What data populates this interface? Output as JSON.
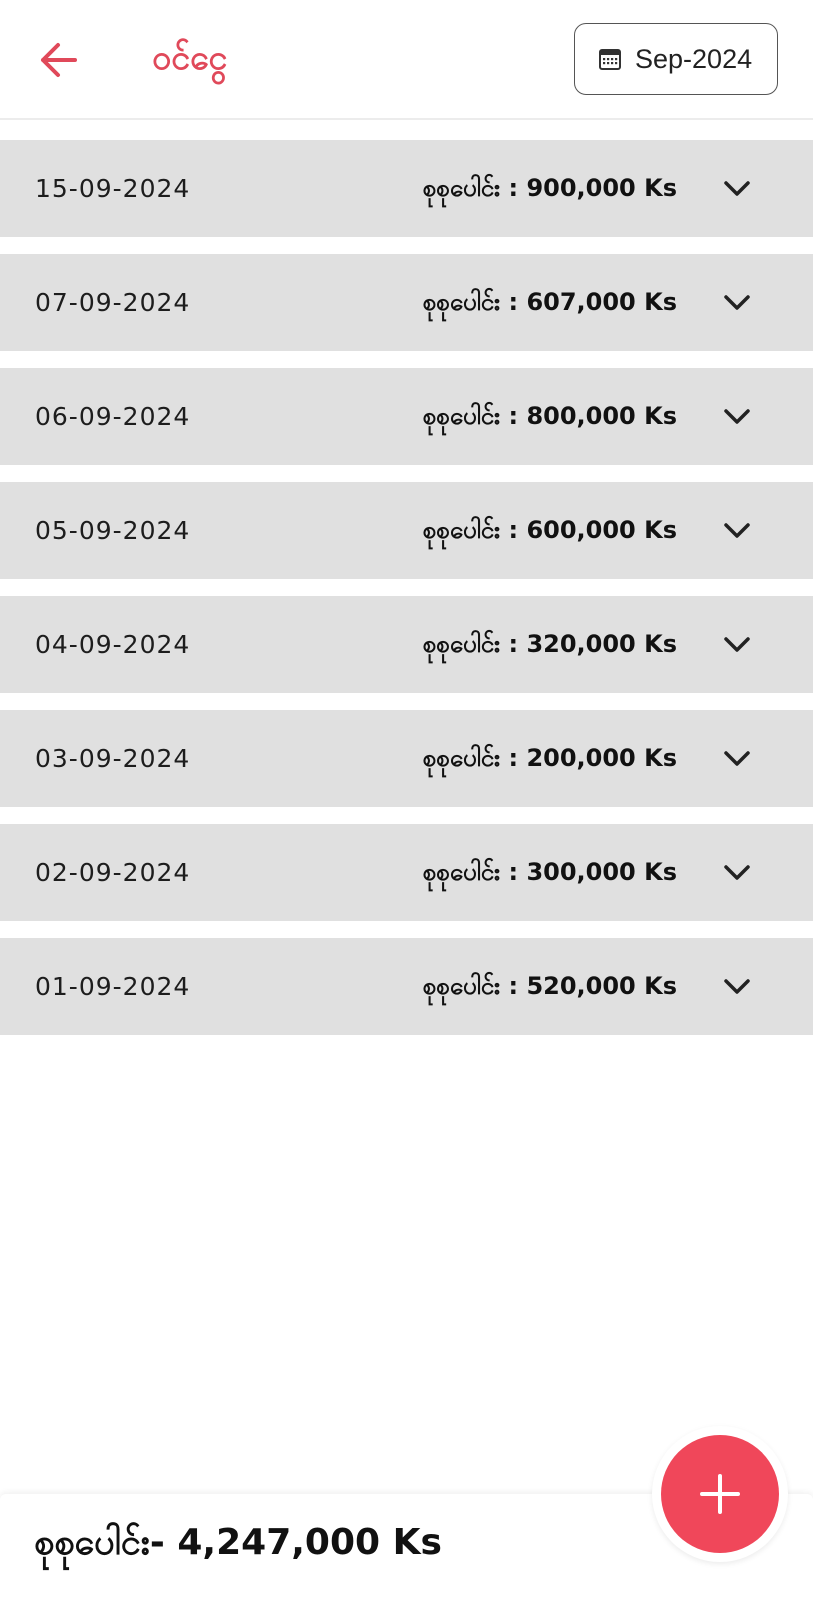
{
  "header": {
    "title": "ဝင်ငွေ",
    "back_icon": "arrow-left-icon",
    "month_picker": {
      "icon": "calendar-icon",
      "label": "Sep-2024"
    }
  },
  "rows": [
    {
      "date": "15-09-2024",
      "total": "စုစုပေါင်း : 900,000 Ks"
    },
    {
      "date": "07-09-2024",
      "total": "စုစုပေါင်း : 607,000 Ks"
    },
    {
      "date": "06-09-2024",
      "total": "စုစုပေါင်း : 800,000 Ks"
    },
    {
      "date": "05-09-2024",
      "total": "စုစုပေါင်း : 600,000 Ks"
    },
    {
      "date": "04-09-2024",
      "total": "စုစုပေါင်း : 320,000 Ks"
    },
    {
      "date": "03-09-2024",
      "total": "စုစုပေါင်း : 200,000 Ks"
    },
    {
      "date": "02-09-2024",
      "total": "စုစုပေါင်း : 300,000 Ks"
    },
    {
      "date": "01-09-2024",
      "total": "စုစုပေါင်း : 520,000 Ks"
    }
  ],
  "footer": {
    "grand_total": "စုစုပေါင်း- 4,247,000 Ks"
  },
  "fab": {
    "icon": "plus-icon"
  },
  "colors": {
    "accent": "#e0495a",
    "fab": "#f0475a",
    "row_bg": "#e0e0e0"
  }
}
